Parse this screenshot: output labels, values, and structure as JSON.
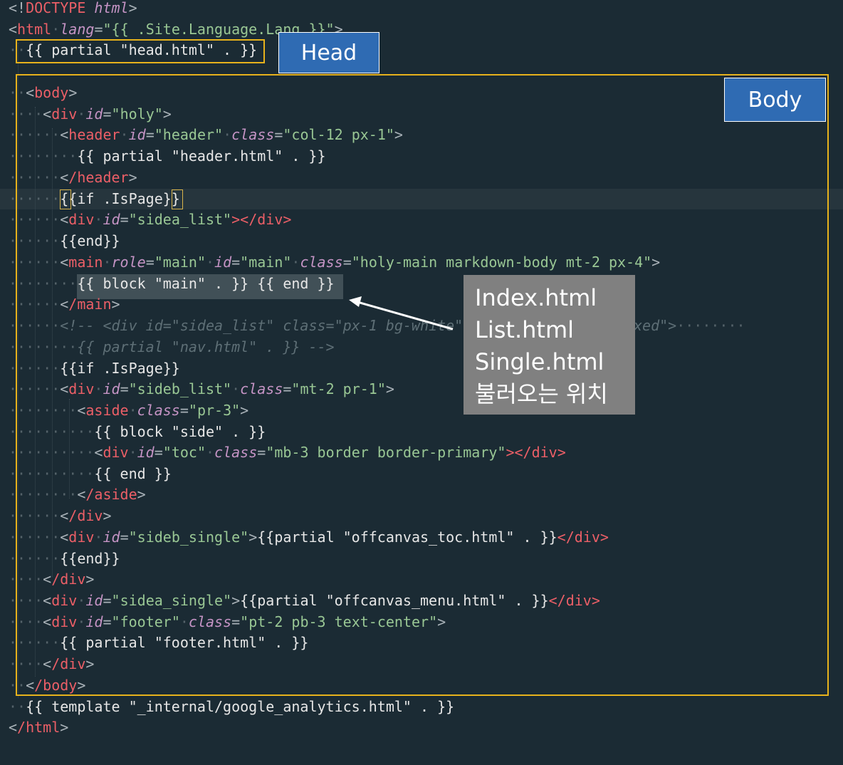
{
  "code": {
    "l1": [
      "<!",
      "DOCTYPE",
      " html",
      ">"
    ],
    "l2_tag": "html",
    "l2_attr": "lang",
    "l2_val": "\"{{ .Site.Language.Lang }}\"",
    "l3": "{{ partial \"head.html\" . }}",
    "l4_tag": "body",
    "l5_tag": "div",
    "l5_attr": "id",
    "l5_val": "\"holy\"",
    "l6_tag": "header",
    "l6_attr1": "id",
    "l6_val1": "\"header\"",
    "l6_attr2": "class",
    "l6_val2": "\"col-12 px-1\"",
    "l7": "{{ partial \"header.html\" . }}",
    "l8_tag": "/header",
    "l9": "{{if .IsPage}}",
    "l10_tag": "div",
    "l10_attr": "id",
    "l10_val": "\"sidea_list\"",
    "l10_close": "></div>",
    "l11": "{{end}}",
    "l12_tag": "main",
    "l12_attr1": "role",
    "l12_val1": "\"main\"",
    "l12_attr2": "id",
    "l12_val2": "\"main\"",
    "l12_attr3": "class",
    "l12_val3": "\"holy-main markdown-body mt-2 px-4\"",
    "l13": "{{ block \"main\" . }} {{ end }}",
    "l14_tag": "/main",
    "l15": "<!-- <div id=\"sidea_list\" class=\"px-1 bg-white\"",
    "l15_tail": "xed\">",
    "l16": "{{ partial \"nav.html\" . }} -->",
    "l17": "{{if .IsPage}}",
    "l18_tag": "div",
    "l18_attr1": "id",
    "l18_val1": "\"sideb_list\"",
    "l18_attr2": "class",
    "l18_val2": "\"mt-2 pr-1\"",
    "l19_tag": "aside",
    "l19_attr": "class",
    "l19_val": "\"pr-3\"",
    "l20": "{{ block \"side\" . }}",
    "l21_tag": "div",
    "l21_attr1": "id",
    "l21_val1": "\"toc\"",
    "l21_attr2": "class",
    "l21_val2": "\"mb-3 border border-primary\"",
    "l21_close": "></div>",
    "l22": "{{ end }}",
    "l23_tag": "/aside",
    "l24_tag": "/div",
    "l25_tag": "div",
    "l25_attr": "id",
    "l25_val": "\"sideb_single\"",
    "l25_mid": "{{partial \"offcanvas_toc.html\" . }}",
    "l25_close": "</div>",
    "l26": "{{end}}",
    "l27_tag": "/div",
    "l28_tag": "div",
    "l28_attr": "id",
    "l28_val": "\"sidea_single\"",
    "l28_mid": "{{partial \"offcanvas_menu.html\" . }}",
    "l28_close": "</div>",
    "l29_tag": "div",
    "l29_attr1": "id",
    "l29_val1": "\"footer\"",
    "l29_attr2": "class",
    "l29_val2": "\"pt-2 pb-3 text-center\"",
    "l30": "{{ partial \"footer.html\" . }}",
    "l31_tag": "/div",
    "l32_tag": "/body",
    "l33": "{{ template \"_internal/google_analytics.html\" . }}",
    "l34_tag": "/html"
  },
  "labels": {
    "head": "Head",
    "body": "Body"
  },
  "callout": {
    "lines": [
      "Index.html",
      "List.html",
      "Single.html",
      "불러오는 위치"
    ]
  },
  "colors": {
    "background": "#1b2b34",
    "highlight_box": "#e7b21c",
    "label_bg": "#2f6bb3",
    "callout_bg": "#808080"
  }
}
